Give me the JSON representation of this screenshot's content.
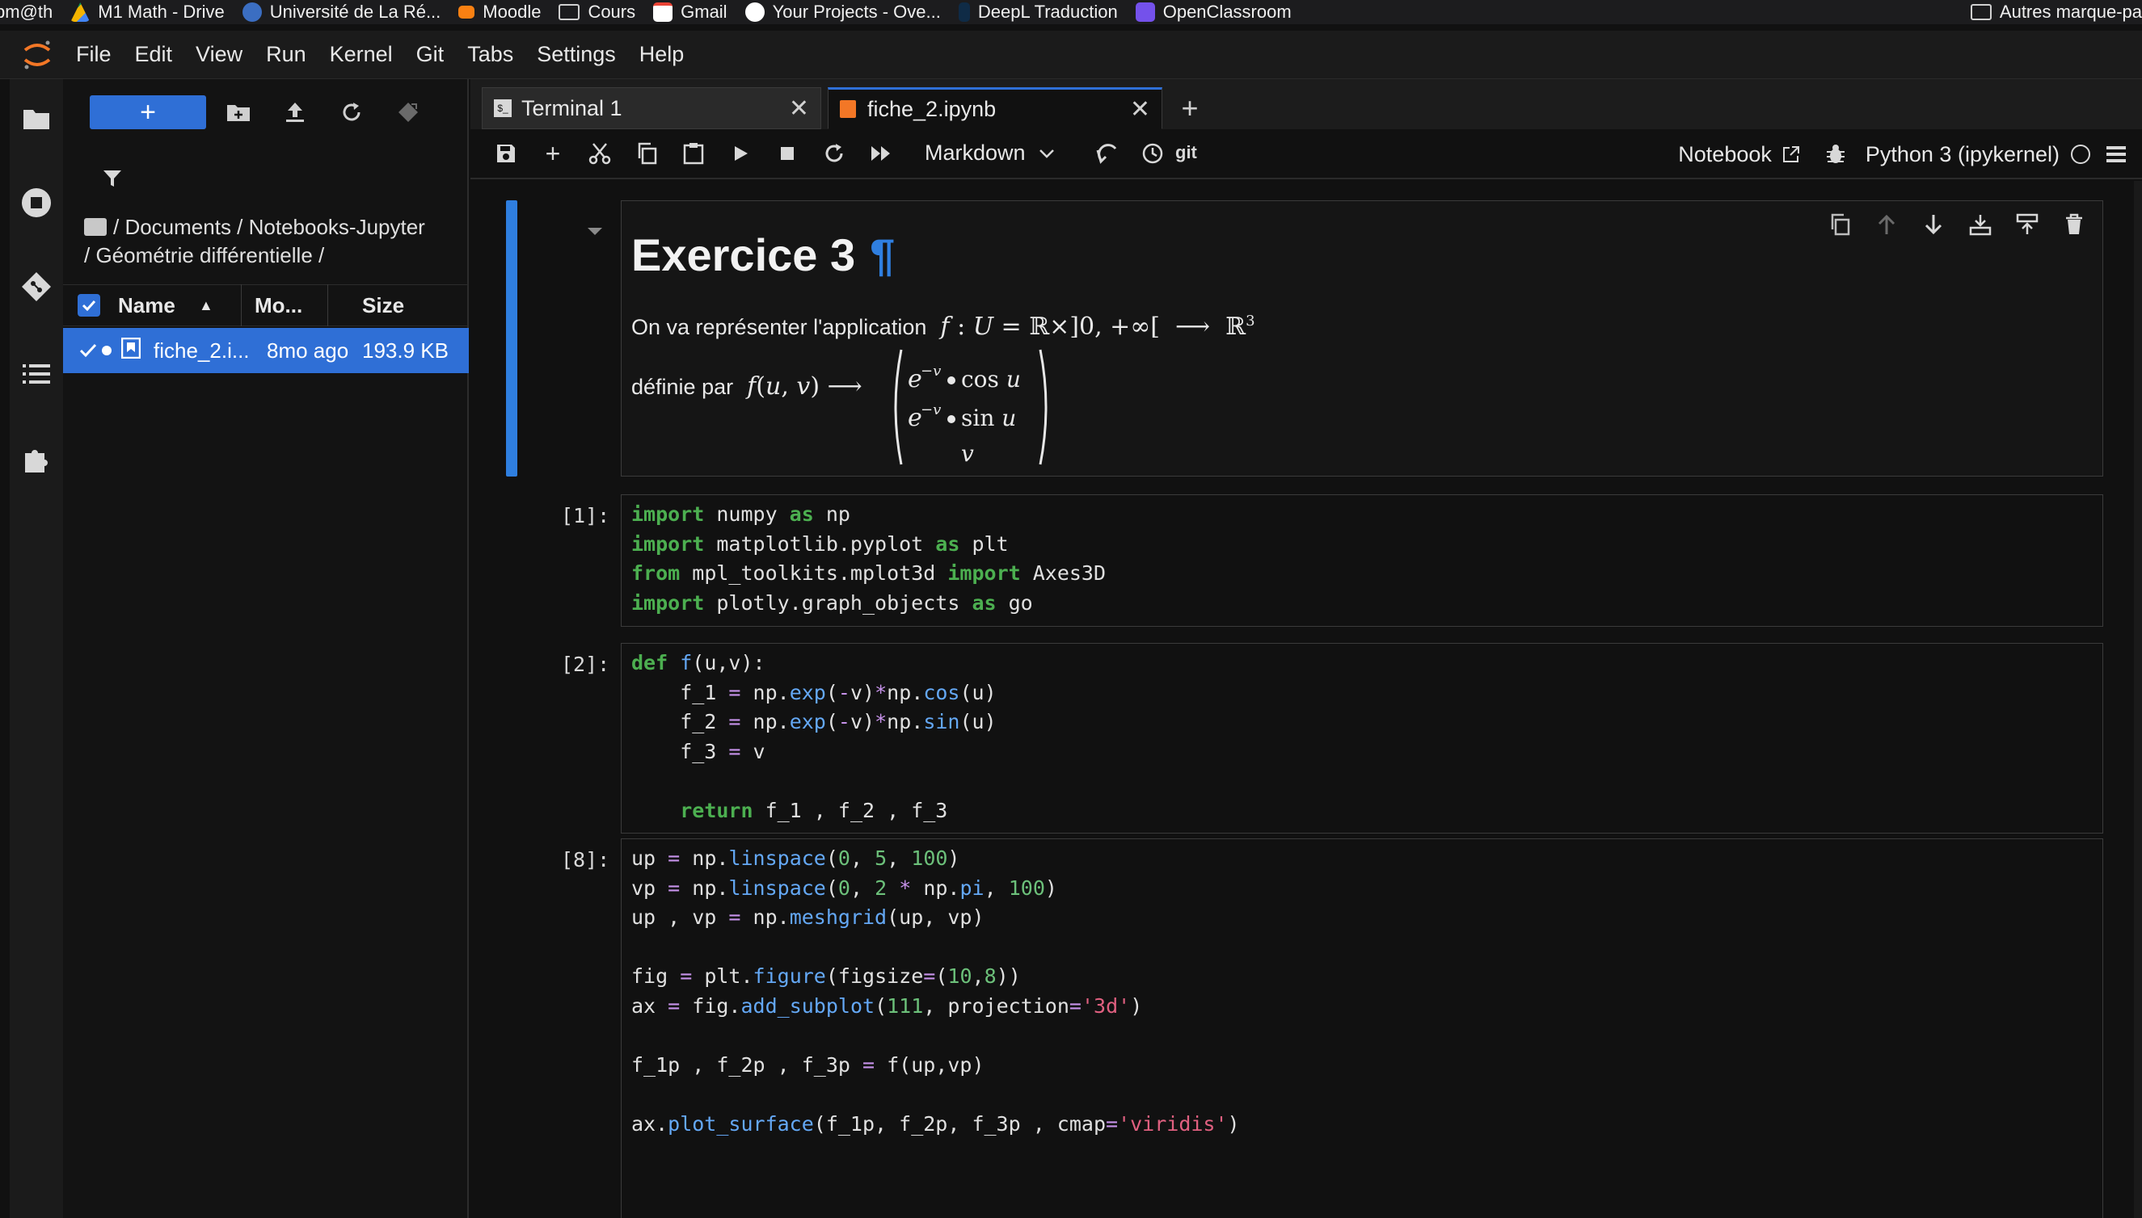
{
  "bookmarks": [
    {
      "label": "bm@th",
      "color": "#000000"
    },
    {
      "label": "M1 Math - Drive",
      "color": "#f4b400"
    },
    {
      "label": "Université de La Ré...",
      "color": "#3b6ec2"
    },
    {
      "label": "Moodle",
      "color": "#f98012"
    },
    {
      "label": "Cours",
      "color": "#d0d0d0"
    },
    {
      "label": "Gmail",
      "color": "#ea4335"
    },
    {
      "label": "Your Projects - Ove...",
      "color": "#ffffff"
    },
    {
      "label": "DeepL Traduction",
      "color": "#0f2b46"
    },
    {
      "label": "OpenClassroom",
      "color": "#7451eb"
    }
  ],
  "bookmarks_right": "Autres marque-pa",
  "menu": [
    "File",
    "Edit",
    "View",
    "Run",
    "Kernel",
    "Git",
    "Tabs",
    "Settings",
    "Help"
  ],
  "filebrowser": {
    "new_button": "+",
    "breadcrumb": "/ Documents / Notebooks-Jupyter / Géométrie différentielle /",
    "columns": {
      "name": "Name",
      "modified": "Mo...",
      "size": "Size"
    },
    "files": [
      {
        "name": "fiche_2.i...",
        "modified": "8mo ago",
        "size": "193.9 KB"
      }
    ]
  },
  "tabs": [
    {
      "label": "Terminal 1",
      "icon": "terminal-icon",
      "active": false
    },
    {
      "label": "fiche_2.ipynb",
      "icon": "notebook-icon",
      "active": true
    }
  ],
  "toolbar": {
    "cell_type": "Markdown",
    "git": "git",
    "notebook_label": "Notebook",
    "kernel": "Python 3 (ipykernel)"
  },
  "cells": {
    "md": {
      "title": "Exercice 3",
      "pilcrow": "¶",
      "line1_prefix": "On va représenter l'application",
      "line2_prefix": "définie par"
    },
    "c1": {
      "prompt": "[1]:"
    },
    "c2": {
      "prompt": "[2]:"
    },
    "c3": {
      "prompt": "[8]:"
    }
  },
  "colors": {
    "accent": "#2f6fd6",
    "keyword": "#4caf50",
    "function": "#64a8f5",
    "number": "#6cc07a",
    "string": "#e06080",
    "operator": "#c792ea"
  }
}
